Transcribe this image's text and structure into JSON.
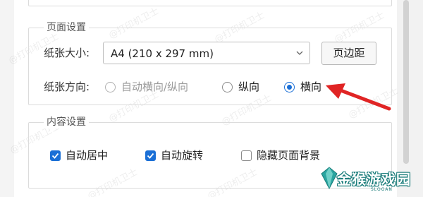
{
  "page_setup": {
    "legend": "页面设置",
    "paper_size_label": "纸张大小:",
    "paper_size_value": "A4 (210 x 297 mm)",
    "margins_button": "页边距",
    "orientation_label": "纸张方向:",
    "orientation_options": [
      {
        "label": "自动横向/纵向",
        "state": "disabled"
      },
      {
        "label": "纵向",
        "state": "unchecked"
      },
      {
        "label": "横向",
        "state": "checked"
      }
    ]
  },
  "content_setup": {
    "legend": "内容设置",
    "options": [
      {
        "label": "自动居中",
        "checked": true
      },
      {
        "label": "自动旋转",
        "checked": true
      },
      {
        "label": "隐藏页面背景",
        "checked": false
      }
    ]
  },
  "watermark_text": "@打印机卫士",
  "logo": {
    "text": "金猴游戏园",
    "sub": "SLOGAN"
  },
  "colors": {
    "accent": "#1a6fd6",
    "annotation_arrow": "#e02424",
    "logo": "#1a7c7a"
  }
}
